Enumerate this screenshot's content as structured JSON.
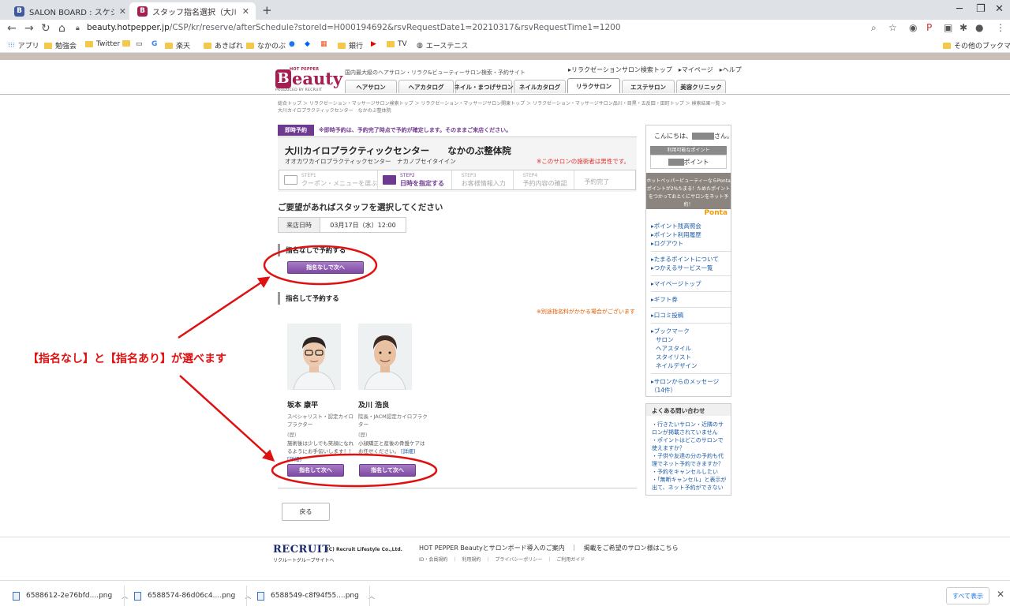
{
  "browser": {
    "tabs": [
      {
        "title": "SALON BOARD : スケジュール",
        "favicon": "B"
      },
      {
        "title": "スタッフ指名選択（大川カイロプラク",
        "favicon": "B"
      }
    ],
    "new_tab": "+",
    "url_host": "beauty.hotpepper.jp",
    "url_path": "/CSP/kr/reserve/afterSchedule?storeId=H000194692&rsvRequestDate1=20210317&rsvRequestTime1=1200",
    "bookmarks": [
      "アプリ",
      "勉強会",
      "Twitter",
      "楽天",
      "あきばれ",
      "なかのぶ",
      "銀行",
      "TV",
      "エーステニス"
    ],
    "other_bookmarks": "その他のブックマーク"
  },
  "header": {
    "logo_top": "HOT PEPPER",
    "logo_b": "B",
    "logo_rest": "eauty",
    "logo_produced": "PRODUCED BY RECRUIT",
    "tagline": "国内最大級のヘアサロン・リラク&ビューティーサロン検索・予約サイト",
    "toplinks": "▸リラクゼーションサロン検索トップ　▸マイページ　▸ヘルプ",
    "nav": [
      "ヘアサロン",
      "ヘアカタログ",
      "ネイル・まつげサロン",
      "ネイルカタログ",
      "リラクサロン",
      "エステサロン",
      "美容クリニック"
    ]
  },
  "breadcrumb": "総合トップ ＞ リラクゼーション・マッサージサロン検索トップ ＞ リラクゼーション・マッサージサロン関東トップ ＞ リラクゼーション・マッサージサロン品川・目黒・五反田・田町トップ ＞ 検索結果一覧 ＞ 大川カイロプラクティックセンター　なかのぶ整体院",
  "instant": {
    "badge": "即時予約",
    "note": "※即時予約は、予約完了時点で予約が確定します。そのままご来店ください。"
  },
  "salon": {
    "name": "大川カイロプラクティックセンター　　なかのぶ整体院",
    "kana": "オオカワカイロプラクティックセンター　ナカノブセイタイイン",
    "note": "※このサロンの施術者は男性です。"
  },
  "steps": [
    {
      "num": "STEP1",
      "label": "クーポン・メニューを選ぶ"
    },
    {
      "num": "STEP2",
      "label": "日時を指定する"
    },
    {
      "num": "STEP3",
      "label": "お客様情報入力"
    },
    {
      "num": "STEP4",
      "label": "予約内容の確認"
    },
    {
      "num": "",
      "label": "予約完了"
    }
  ],
  "page_title": "ご要望があればスタッフを選択してください",
  "visit": {
    "label": "来店日時",
    "value": "03月17日（水）12:00"
  },
  "no_nomination": {
    "heading": "指名なしで予約する",
    "button": "指名なしで次へ"
  },
  "nomination": {
    "heading": "指名して予約する",
    "fee_note": "※別途指名料がかかる場合がございます",
    "staff": [
      {
        "name": "坂本 康平",
        "role": "スペシャリスト・認定カイロプラクター",
        "kana": "(歴)",
        "comment": "施術後は少しでも笑顔になれるようにお手伝いします！！",
        "more": "[詳細]",
        "button": "指名して次へ"
      },
      {
        "name": "及川 浩良",
        "role": "院長・JACM認定カイロプラクター",
        "kana": "(歴)",
        "comment": "小顔矯正と産後の骨盤ケアはお任せください。",
        "more": "[詳細]",
        "button": "指名して次へ"
      }
    ]
  },
  "back_button": "戻る",
  "annotation": "【指名なし】と【指名あり】が選べます",
  "sidebar": {
    "greeting_pre": "こんにちは、",
    "greeting_post": "さん。",
    "points_head": "利用可能なポイント",
    "points_unit": "ポイント",
    "ponta_text": "ホットペッパービューティーならPontaポイントが2%たまる！ためたポイントをつかっておとくにサロンをネット予約！",
    "ponta_logo": "Ponta",
    "links1": [
      "▸ポイント残高照会",
      "▸ポイント利用履歴",
      "▸ログアウト"
    ],
    "links2": [
      "▸たまるポイントについて",
      "▸つかえるサービス一覧"
    ],
    "links3": [
      "▸マイページトップ",
      "▸ギフト券",
      "▸口コミ投稿",
      "▸ブックマーク"
    ],
    "bookmark_sub": [
      "サロン",
      "ヘアスタイル",
      "スタイリスト",
      "ネイルデザイン"
    ],
    "message": "▸サロンからのメッセージ（14件）",
    "faq_head": "よくある問い合わせ",
    "faq": [
      "・行きたいサロン・近隣のサロンが掲載されていません",
      "・ポイントはどこのサロンで使えますか？",
      "・子供や友達の分の予約も代理でネット予約できますか？",
      "・予約をキャンセルしたい",
      "・「無断キャンセル」と表示が出て、ネット予約ができない"
    ]
  },
  "footer": {
    "recruit": "RECRUIT",
    "recruit_ls": "(C) Recruit Lifestyle Co.,Ltd.",
    "group": "リクルートグループサイトへ",
    "links": "HOT PEPPER Beautyとサロンボード導入のご案内　｜　掲載をご希望のサロン様はこちら",
    "links2": "ID・会員規約　｜　利用規約　｜　プライバシーポリシー　｜　ご利用ガイド"
  },
  "downloads": {
    "files": [
      "6588612-2e76bfd....png",
      "6588574-86d06c4....png",
      "6588549-c8f94f55....png"
    ],
    "show_all": "すべて表示"
  },
  "colors": {
    "brand": "#a61d51",
    "accent_purple": "#6e3a90",
    "annotation_red": "#e01010"
  }
}
